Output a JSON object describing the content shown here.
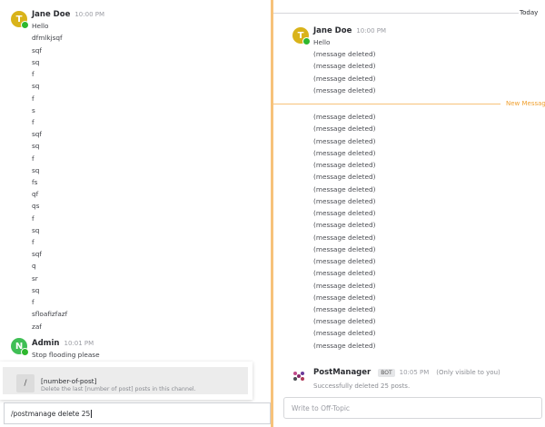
{
  "left": {
    "messages": [
      {
        "author": "Jane Doe",
        "initial": "T",
        "time": "10:00 PM",
        "avatar_color": "#d9b31a",
        "lines": [
          "Hello",
          "dfmlkjsqf",
          "sqf",
          "sq",
          "f",
          "sq",
          "f",
          "s",
          "f",
          "sqf",
          "sq",
          "f",
          "sq",
          "fs",
          "qf",
          "qs",
          "f",
          "sq",
          "f",
          "sqf",
          "q",
          "sr",
          "sq",
          "f",
          "sfloafizfazf",
          "zaf"
        ]
      },
      {
        "author": "Admin",
        "initial": "N",
        "time": "10:01 PM",
        "avatar_color": "#3fbf55",
        "lines": [
          "Stop flooding please"
        ]
      }
    ],
    "suggestion": {
      "icon": "/",
      "title": "[number-of-post]",
      "description": "Delete the last [number of post] posts in this channel."
    },
    "composer_value": "/postmanage delete 25"
  },
  "right": {
    "date_divider": "Today",
    "new_messages_label": "New Messag",
    "jane": {
      "author": "Jane Doe",
      "initial": "T",
      "time": "10:00 PM",
      "avatar_color": "#d9b31a",
      "first_line": "Hello"
    },
    "deleted_text": "(message deleted)",
    "bot": {
      "author": "PostManager",
      "badge": "BOT",
      "time": "10:05 PM",
      "visibility": "(Only visible to you)",
      "message": "Successfully deleted 25 posts."
    },
    "composer_placeholder": "Write to Off-Topic"
  },
  "colors": {
    "divider": "#f7c27a",
    "new_messages": "#f0a030",
    "online": "#2eb82e"
  }
}
